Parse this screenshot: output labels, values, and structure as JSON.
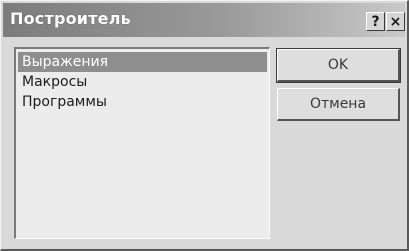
{
  "window": {
    "title": "Построитель",
    "help_glyph": "?",
    "close_glyph": "×"
  },
  "list": {
    "items": [
      {
        "label": "Выражения",
        "selected": true
      },
      {
        "label": "Макросы",
        "selected": false
      },
      {
        "label": "Программы",
        "selected": false
      }
    ]
  },
  "buttons": {
    "ok_label": "OK",
    "cancel_label": "Отмена"
  }
}
